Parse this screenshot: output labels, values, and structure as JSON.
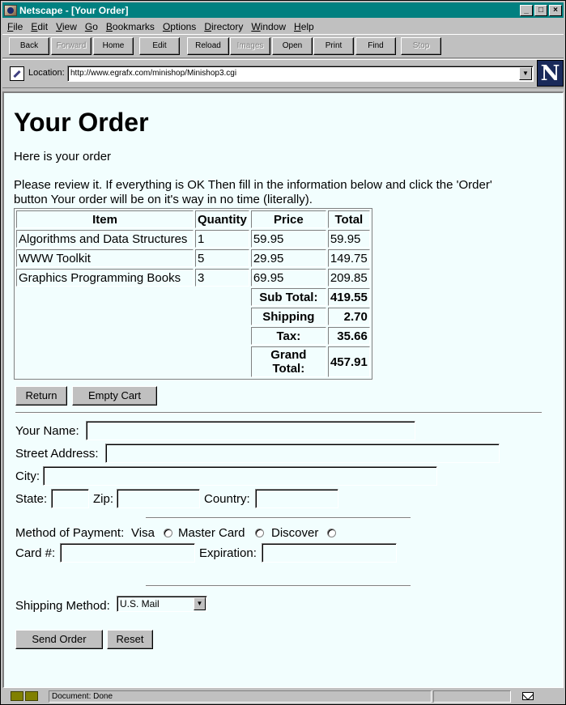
{
  "window": {
    "title": "Netscape - [Your Order]",
    "controls": [
      "_",
      "□",
      "×"
    ]
  },
  "menu": [
    {
      "u": "F",
      "rest": "ile"
    },
    {
      "u": "E",
      "rest": "dit"
    },
    {
      "u": "V",
      "rest": "iew"
    },
    {
      "u": "G",
      "rest": "o"
    },
    {
      "u": "B",
      "rest": "ookmarks"
    },
    {
      "u": "O",
      "rest": "ptions"
    },
    {
      "u": "D",
      "rest": "irectory"
    },
    {
      "u": "W",
      "rest": "indow"
    },
    {
      "u": "H",
      "rest": "elp"
    }
  ],
  "toolbar": {
    "back": "Back",
    "forward": "Forward",
    "home": "Home",
    "edit": "Edit",
    "reload": "Reload",
    "images": "Images",
    "open": "Open",
    "print": "Print",
    "find": "Find",
    "stop": "Stop"
  },
  "location": {
    "label": "Location:",
    "url": "http://www.egrafx.com/minishop/Minishop3.cgi",
    "logo": "N"
  },
  "page": {
    "title": "Your Order",
    "intro": "Here is your order",
    "review": "Please review it. If everything is OK Then fill in the information below and click the 'Order' button Your order will be on it's way in no time (literally)."
  },
  "order_table": {
    "headers": [
      "Item",
      "Quantity",
      "Price",
      "Total"
    ],
    "rows": [
      {
        "item": "Algorithms and Data Structures",
        "qty": "1",
        "price": "59.95",
        "total": "59.95"
      },
      {
        "item": "WWW Toolkit",
        "qty": "5",
        "price": "29.95",
        "total": "149.75"
      },
      {
        "item": "Graphics Programming Books",
        "qty": "3",
        "price": "69.95",
        "total": "209.85"
      }
    ],
    "summary": [
      {
        "label": "Sub Total:",
        "value": "419.55"
      },
      {
        "label": "Shipping",
        "value": "2.70"
      },
      {
        "label": "Tax:",
        "value": "35.66"
      },
      {
        "label": "Grand Total:",
        "value": "457.91"
      }
    ]
  },
  "cart_buttons": {
    "return": "Return",
    "empty": "Empty Cart"
  },
  "form": {
    "name_label": "Your Name:",
    "street_label": "Street Address:",
    "city_label": "City:",
    "state_label": "State:",
    "zip_label": "Zip:",
    "country_label": "Country:",
    "payment_label": "Method of Payment:",
    "visa": "Visa",
    "master": "Master Card",
    "discover": "Discover",
    "card_label": "Card #:",
    "expiration_label": "Expiration:",
    "shipping_method_label": "Shipping Method:",
    "shipping_method_value": "U.S. Mail",
    "send": "Send Order",
    "reset": "Reset"
  },
  "status": {
    "text": "Document: Done"
  }
}
